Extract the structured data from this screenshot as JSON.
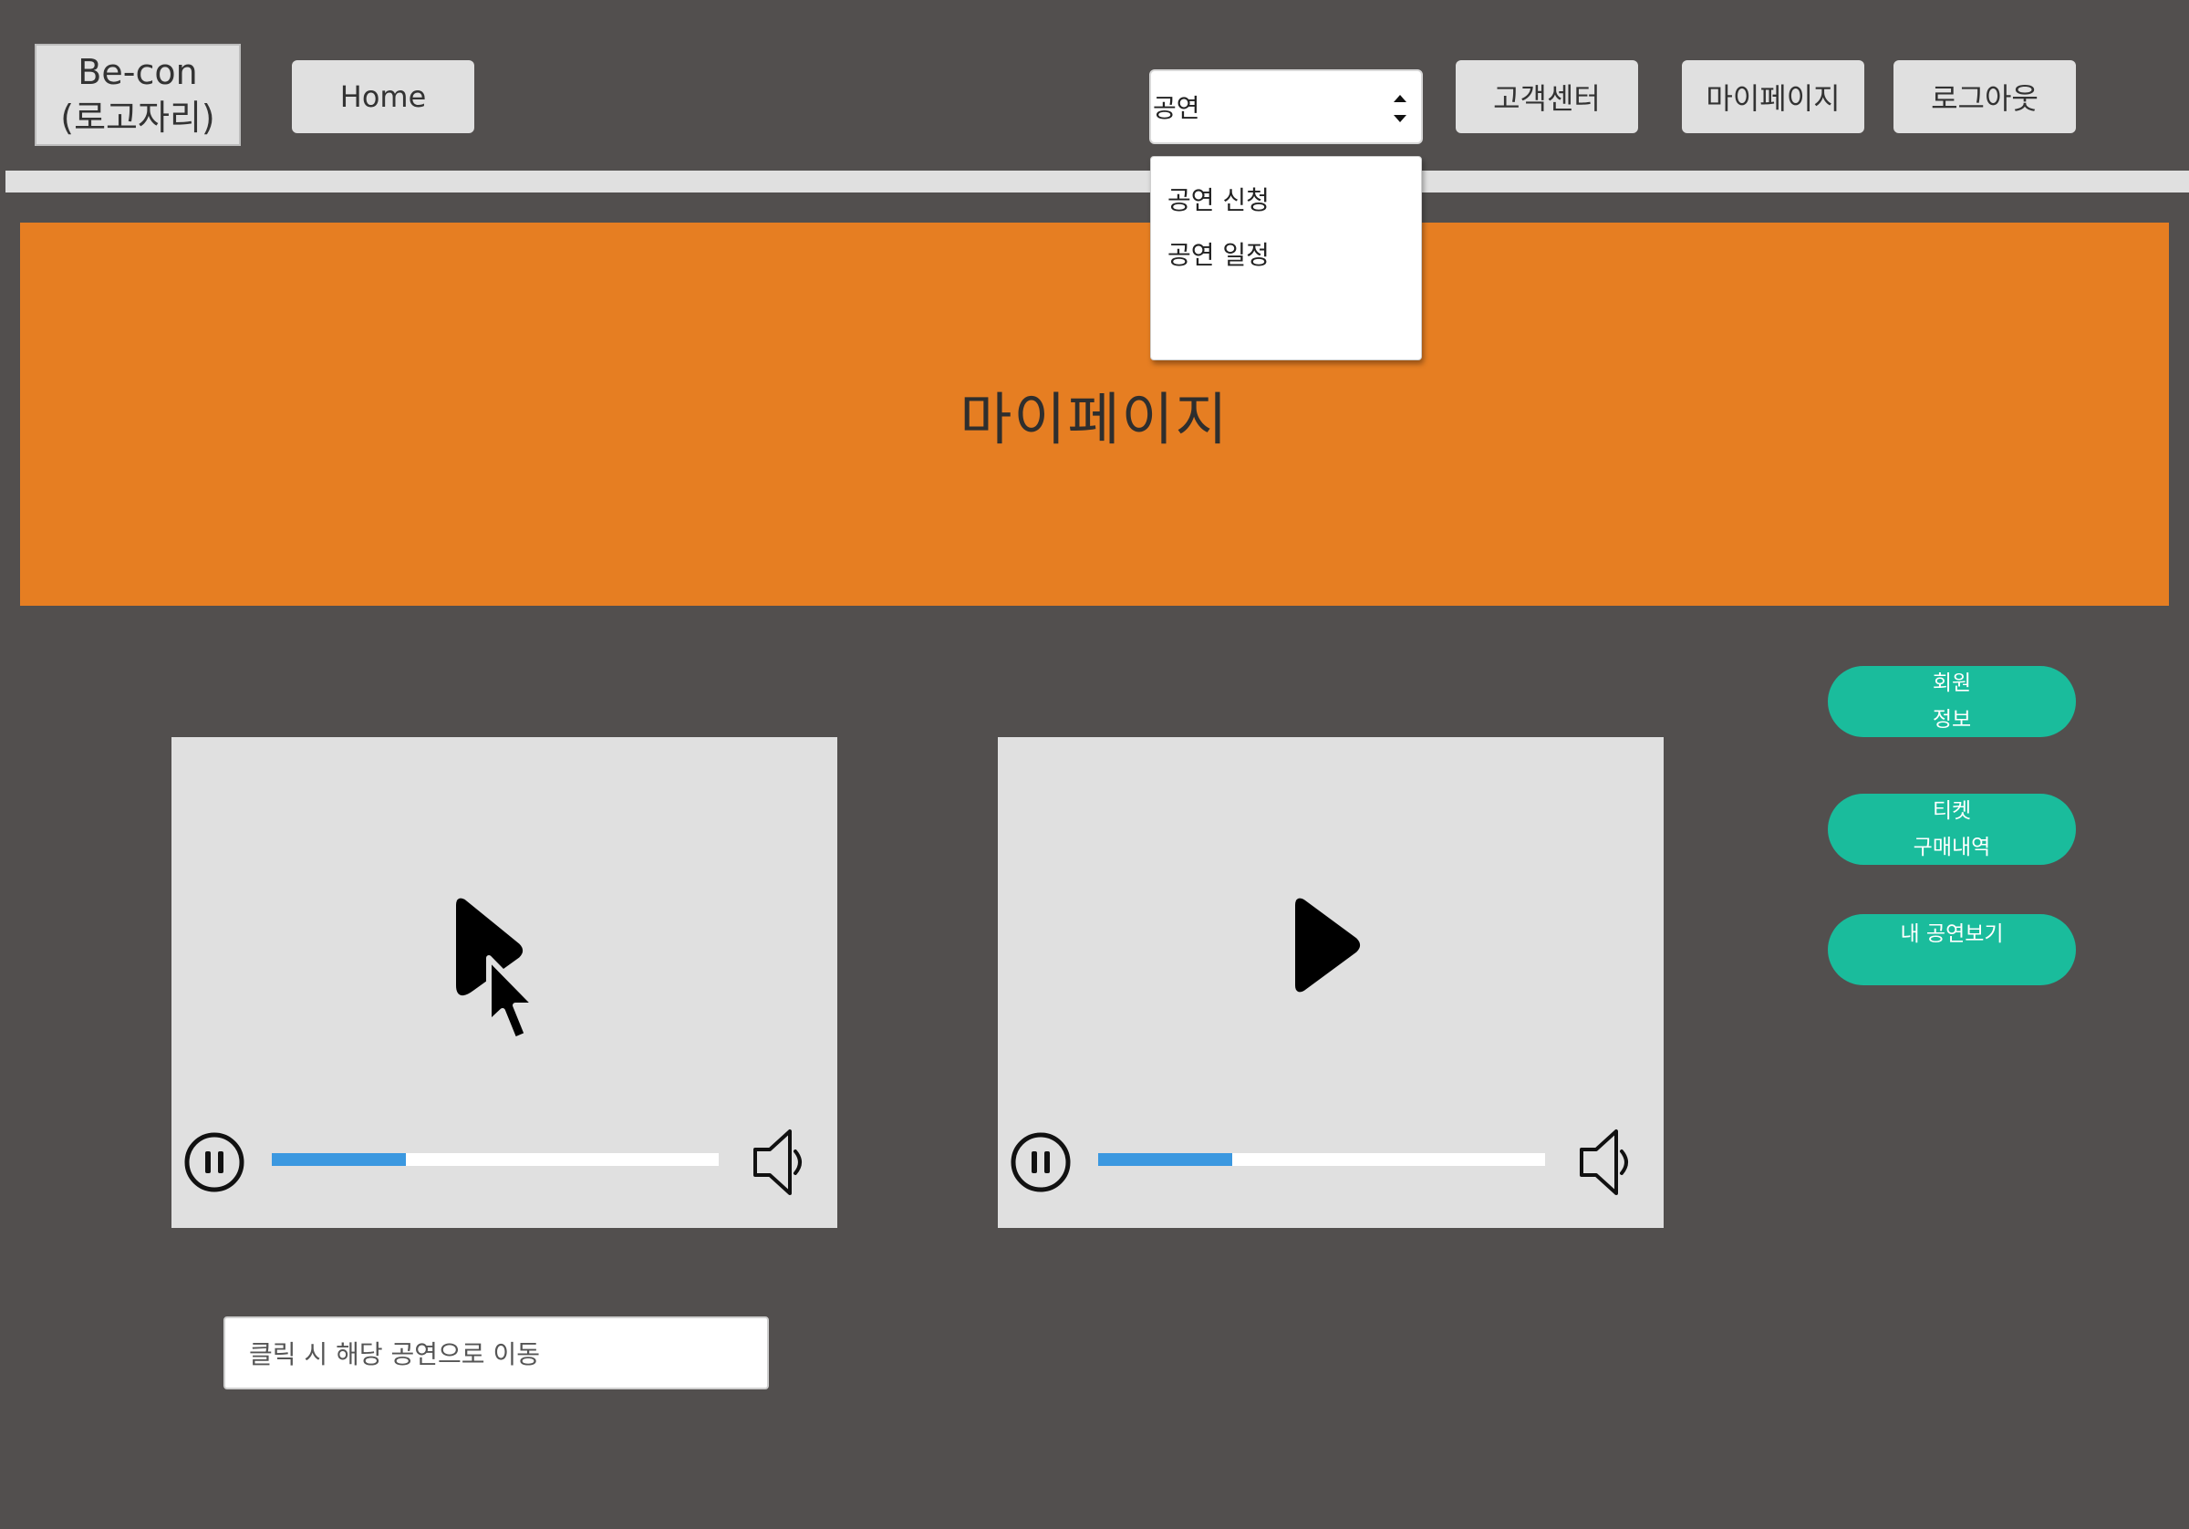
{
  "header": {
    "logo_line1": "Be-con",
    "logo_line2": "(로고자리)",
    "home_label": "Home",
    "select_value": "공연",
    "customer_center_label": "고객센터",
    "mypage_label": "마이페이지",
    "logout_label": "로그아웃"
  },
  "dropdown": {
    "items": [
      "공연 신청",
      "공연 일정"
    ]
  },
  "banner": {
    "title": "마이페이지"
  },
  "side_menu": {
    "member_info_line1": "회원",
    "member_info_line2": "정보",
    "ticket_line1": "티켓",
    "ticket_line2": "구매내역",
    "my_shows_label": "내 공연보기"
  },
  "videos": [
    {
      "center_icon": "cursor-icon",
      "progress": 0.3
    },
    {
      "center_icon": "play-icon",
      "progress": 0.3
    }
  ],
  "link_box": {
    "text": "클릭 시 해당 공연으로 이동"
  },
  "colors": {
    "background": "#524f4e",
    "banner": "#e67e22",
    "accent_green": "#1abc9c",
    "progress_blue": "#3b98e0",
    "panel_gray": "#e0e0e0"
  }
}
